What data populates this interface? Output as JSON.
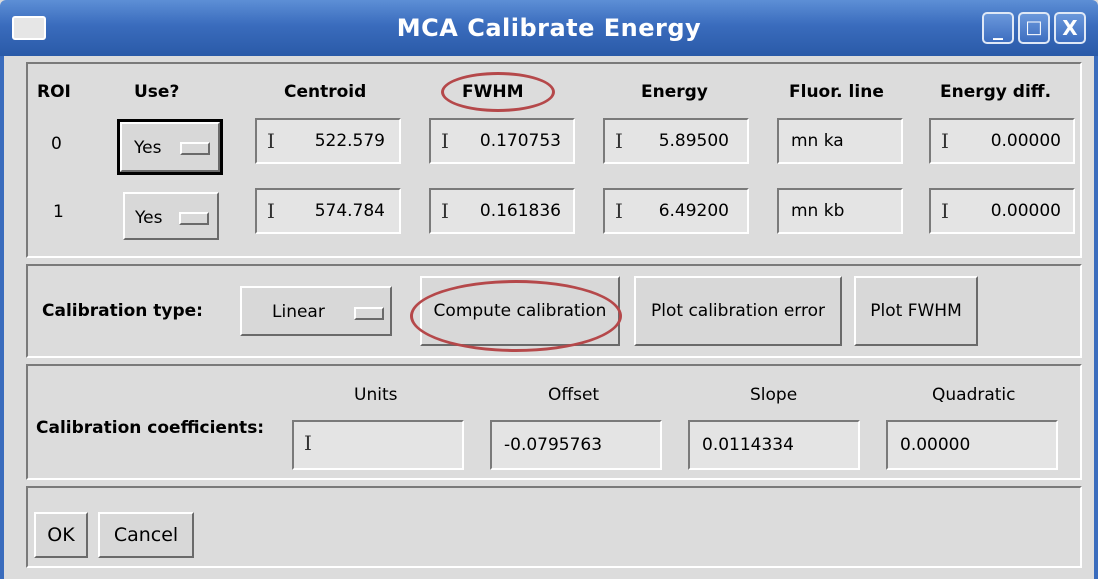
{
  "window": {
    "title": "MCA Calibrate Energy",
    "controls": [
      "_",
      "□",
      "X"
    ]
  },
  "roi_table": {
    "headers": {
      "roi": "ROI",
      "use": "Use?",
      "centroid": "Centroid",
      "fwhm": "FWHM",
      "energy": "Energy",
      "fluor_line": "Fluor. line",
      "energy_diff": "Energy diff."
    },
    "rows": [
      {
        "roi": "0",
        "use": "Yes",
        "centroid": "522.579",
        "fwhm": "0.170753",
        "energy": "5.89500",
        "fluor_line": "mn ka",
        "energy_diff": "0.00000"
      },
      {
        "roi": "1",
        "use": "Yes",
        "centroid": "574.784",
        "fwhm": "0.161836",
        "energy": "6.49200",
        "fluor_line": "mn kb",
        "energy_diff": "0.00000"
      }
    ]
  },
  "calibration": {
    "type_label": "Calibration type:",
    "type_value": "Linear",
    "compute_button": "Compute calibration",
    "plot_error_button": "Plot calibration error",
    "plot_fwhm_button": "Plot FWHM"
  },
  "coefficients": {
    "label": "Calibration coefficients:",
    "headers": {
      "units": "Units",
      "offset": "Offset",
      "slope": "Slope",
      "quadratic": "Quadratic"
    },
    "values": {
      "units": "",
      "offset": "-0.0795763",
      "slope": "0.0114334",
      "quadratic": "0.00000"
    }
  },
  "footer": {
    "ok": "OK",
    "cancel": "Cancel"
  },
  "colors": {
    "titlebar": "#3a6cbd",
    "annotation_ring": "#b5484a",
    "background": "#dcdcdc"
  }
}
